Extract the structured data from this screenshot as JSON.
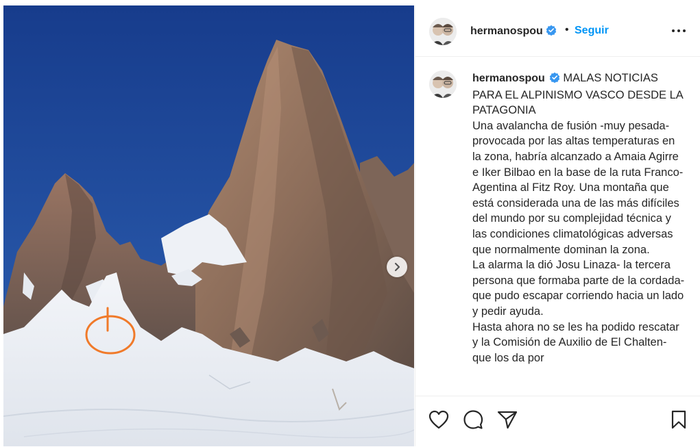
{
  "post": {
    "author": {
      "username": "hermanospou",
      "verified": true
    },
    "follow_label": "Seguir",
    "separator": "•",
    "caption": {
      "title": "MALAS NOTICIAS PARA EL ALPINISMO VASCO DESDE LA PATAGONIA",
      "paragraphs": [
        "Una avalancha de fusión -muy pesada- provocada por las altas temperaturas en la zona, habría alcanzado a Amaia Agirre e Iker Bilbao en la base de la ruta Franco-Agentina al Fitz Roy. Una montaña que está considerada una de las más difíciles del mundo por su complejidad técnica y las condiciones climatológicas adversas que normalmente dominan la zona.",
        "La alarma la dió Josu Linaza- la tercera persona que formaba parte de la cordada-que pudo escapar corriendo hacia un lado y pedir ayuda.",
        "Hasta ahora no se les ha podido rescatar y la Comisión de Auxilio de El Chalten- que los da por"
      ]
    },
    "icons": {
      "verified": "verified-badge-icon",
      "more": "more-options-icon",
      "next": "chevron-right-icon",
      "like": "heart-icon",
      "comment": "comment-icon",
      "share": "paper-plane-icon",
      "save": "bookmark-icon"
    },
    "colors": {
      "accent": "#0095f6",
      "text": "#262626",
      "annotation": "#f07a2a",
      "sky": "#1a3f8f"
    }
  }
}
